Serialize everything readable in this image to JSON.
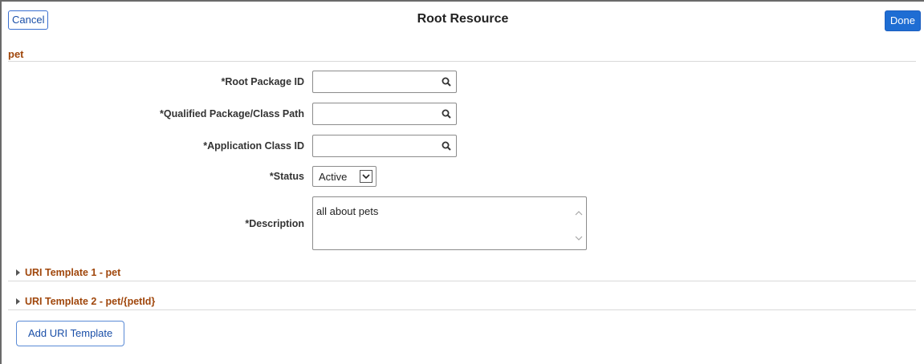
{
  "header": {
    "title": "Root Resource",
    "cancel_label": "Cancel",
    "done_label": "Done"
  },
  "section": {
    "title": "pet"
  },
  "form": {
    "root_package_id": {
      "label": "*Root Package ID",
      "value": ""
    },
    "qualified_path": {
      "label": "*Qualified Package/Class Path",
      "value": ""
    },
    "app_class_id": {
      "label": "*Application Class ID",
      "value": ""
    },
    "status": {
      "label": "*Status",
      "value": "Active"
    },
    "description": {
      "label": "*Description",
      "value": "all about pets"
    }
  },
  "uri_templates": [
    {
      "label": "URI Template 1 - pet"
    },
    {
      "label": "URI Template 2 - pet/{petId}"
    }
  ],
  "add_uri_template_label": "Add URI Template",
  "icons": {
    "lookup": "search-icon",
    "dropdown": "chevron-down-icon",
    "expand": "triangle-right-icon"
  },
  "colors": {
    "section_title": "#a0470c",
    "primary_button": "#1e6dd3",
    "link_blue": "#1a4fa8"
  }
}
